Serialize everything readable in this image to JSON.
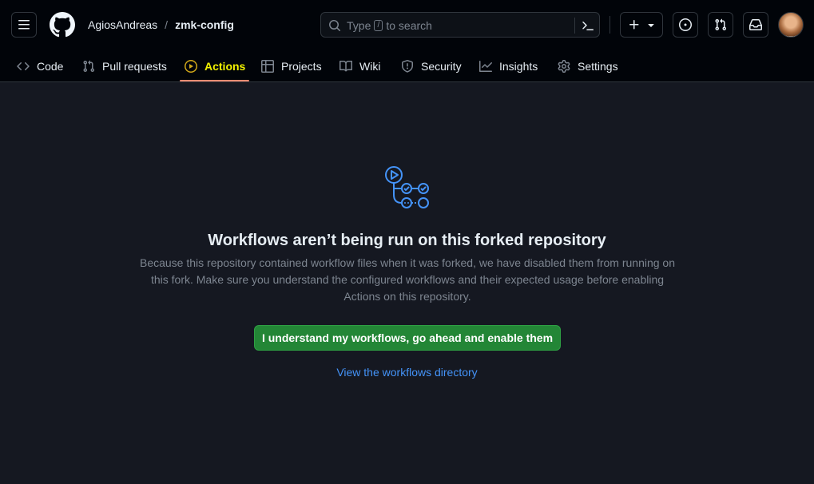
{
  "header": {
    "owner": "AgiosAndreas",
    "separator": "/",
    "repo": "zmk-config",
    "search": {
      "prefix": "Type",
      "key": "/",
      "suffix": "to search"
    }
  },
  "tabs": [
    {
      "label": "Code",
      "icon": "code-icon",
      "active": false
    },
    {
      "label": "Pull requests",
      "icon": "pull-request-icon",
      "active": false
    },
    {
      "label": "Actions",
      "icon": "play-circle-icon",
      "active": true
    },
    {
      "label": "Projects",
      "icon": "table-icon",
      "active": false
    },
    {
      "label": "Wiki",
      "icon": "book-icon",
      "active": false
    },
    {
      "label": "Security",
      "icon": "shield-icon",
      "active": false
    },
    {
      "label": "Insights",
      "icon": "graph-icon",
      "active": false
    },
    {
      "label": "Settings",
      "icon": "gear-icon",
      "active": false
    }
  ],
  "main": {
    "title": "Workflows aren’t being run on this forked repository",
    "description_lines": [
      "Because this repository contained workflow files when it was forked, we have disabled them from running on",
      "this fork. Make sure you understand the configured workflows and their expected usage before enabling",
      "Actions on this repository."
    ],
    "enable_button": "I understand my workflows, go ahead and enable them",
    "directory_link": "View the workflows directory"
  },
  "colors": {
    "background": "#151821",
    "header_background": "#010409",
    "active_tab_text": "#f2f200",
    "active_tab_underline": "#fd8c73",
    "primary_button": "#238636",
    "link": "#4493f8",
    "icon_accent": "#4493f8"
  }
}
